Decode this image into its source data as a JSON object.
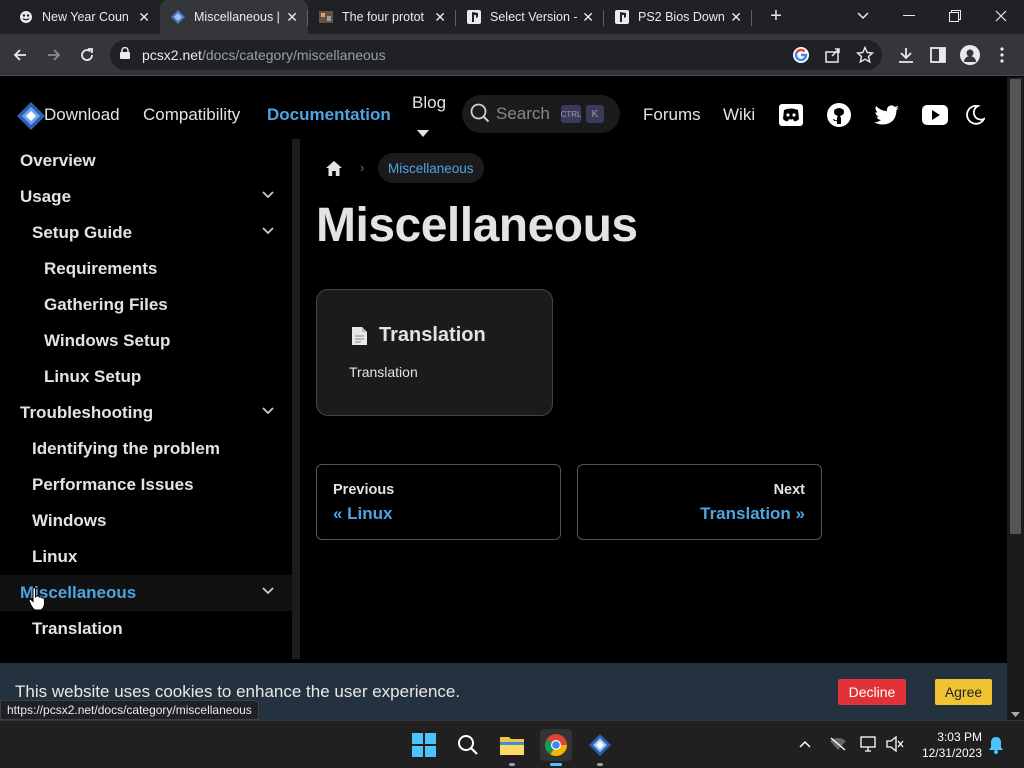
{
  "browser": {
    "tabs": [
      {
        "label": "New Year Coun",
        "icon": "globe-icon"
      },
      {
        "label": "Miscellaneous |",
        "icon": "pcsx2-icon"
      },
      {
        "label": "The four protot",
        "icon": "image-icon"
      },
      {
        "label": "Select Version -",
        "icon": "playstation-icon"
      },
      {
        "label": "PS2 Bios Down",
        "icon": "playstation-icon"
      }
    ],
    "url_host": "pcsx2.net",
    "url_path": "/docs/category/miscellaneous"
  },
  "header": {
    "nav": {
      "download": "Download",
      "compatibility": "Compatibility",
      "documentation": "Documentation",
      "blog": "Blog",
      "forums": "Forums",
      "wiki": "Wiki"
    },
    "search_placeholder": "Search",
    "kbd_ctrl": "CTRL",
    "kbd_k": "K",
    "accent": "#4fa3e0"
  },
  "sidebar": {
    "items": [
      {
        "label": "Overview"
      },
      {
        "label": "Usage"
      },
      {
        "label": "Setup Guide"
      },
      {
        "label": "Requirements"
      },
      {
        "label": "Gathering Files"
      },
      {
        "label": "Windows Setup"
      },
      {
        "label": "Linux Setup"
      },
      {
        "label": "Troubleshooting"
      },
      {
        "label": "Identifying the problem"
      },
      {
        "label": "Performance Issues"
      },
      {
        "label": "Windows"
      },
      {
        "label": "Linux"
      },
      {
        "label": "Miscellaneous"
      },
      {
        "label": "Translation"
      }
    ]
  },
  "main": {
    "breadcrumb_current": "Miscellaneous",
    "title": "Miscellaneous",
    "card": {
      "title": "Translation",
      "description": "Translation"
    },
    "pager": {
      "prev_sub": "Previous",
      "prev_label": "« Linux",
      "next_sub": "Next",
      "next_label": "Translation »"
    }
  },
  "cookie": {
    "text": "This website uses cookies to enhance the user experience.",
    "decline": "Decline",
    "agree": "Agree"
  },
  "status_url": "https://pcsx2.net/docs/category/miscellaneous",
  "taskbar": {
    "time": "3:03 PM",
    "date": "12/31/2023"
  }
}
